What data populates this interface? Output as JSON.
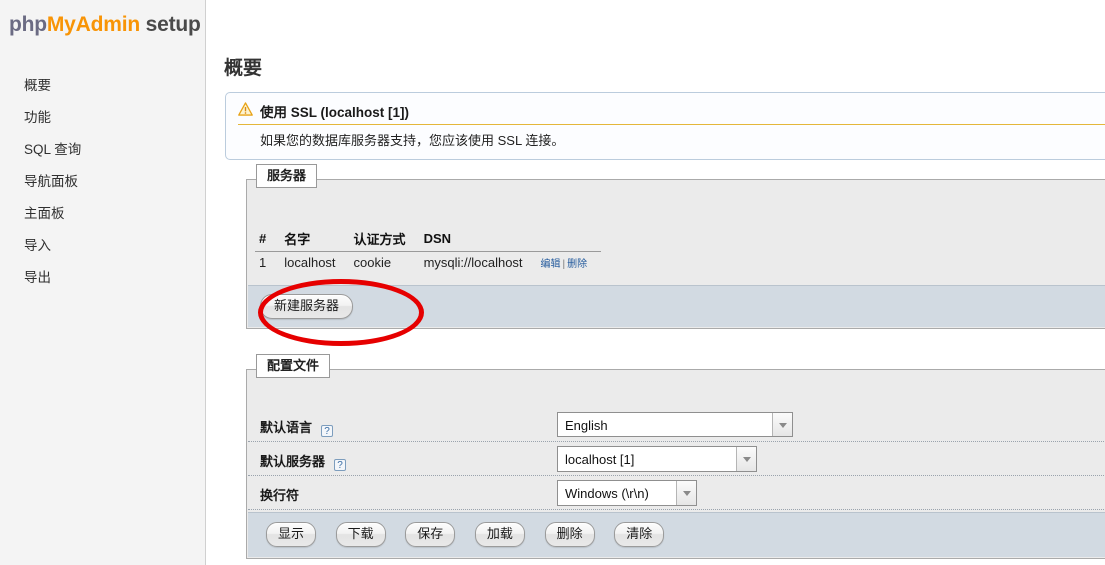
{
  "app": {
    "logo_php": "php",
    "logo_myadmin": "MyAdmin",
    "logo_setup": "setup",
    "accent_orange": "#f89406",
    "accent_purple": "#6b6b83",
    "annotation_color": "#e60000"
  },
  "sidebar": {
    "items": [
      {
        "label": "概要"
      },
      {
        "label": "功能"
      },
      {
        "label": "SQL 查询"
      },
      {
        "label": "导航面板"
      },
      {
        "label": "主面板"
      },
      {
        "label": "导入"
      },
      {
        "label": "导出"
      }
    ]
  },
  "main": {
    "page_title": "概要",
    "notice": {
      "icon": "warning-triangle-icon",
      "title": "使用 SSL (localhost [1])",
      "text": "如果您的数据库服务器支持，您应该使用 SSL 连接。"
    },
    "servers_fieldset": {
      "legend": "服务器",
      "table": {
        "headers": [
          "#",
          "名字",
          "认证方式",
          "DSN",
          ""
        ],
        "rows": [
          {
            "num": "1",
            "name": "localhost",
            "auth": "cookie",
            "dsn": "mysqli://localhost",
            "edit": "编辑",
            "separator": "|",
            "delete": "删除"
          }
        ]
      },
      "new_server_button": "新建服务器"
    },
    "config_fieldset": {
      "legend": "配置文件",
      "rows": [
        {
          "label": "默认语言",
          "help": "?",
          "has_help": true,
          "value": "English"
        },
        {
          "label": "默认服务器",
          "help": "?",
          "has_help": true,
          "value": "localhost [1]"
        },
        {
          "label": "换行符",
          "help": "",
          "has_help": false,
          "value": "Windows (\\r\\n)"
        }
      ],
      "buttons": [
        {
          "label": "显示"
        },
        {
          "label": "下载"
        },
        {
          "label": "保存"
        },
        {
          "label": "加载"
        },
        {
          "label": "删除"
        },
        {
          "label": "清除"
        }
      ]
    }
  }
}
